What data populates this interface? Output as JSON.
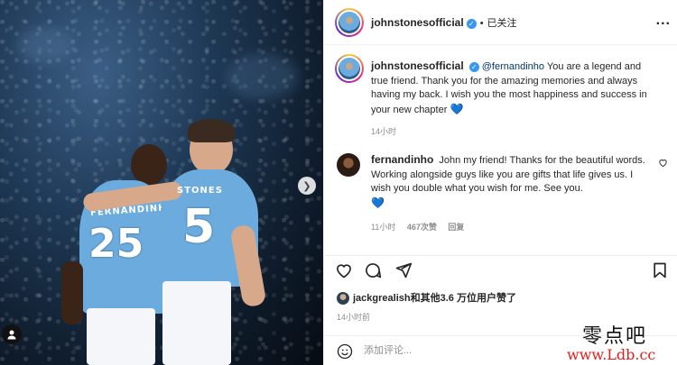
{
  "post": {
    "author": "johnstonesofficial",
    "follow_status": "已关注",
    "header_separator": "•",
    "more_label": "..."
  },
  "photo": {
    "jersey_left_name": "FERNANDINHO",
    "jersey_left_number": "25",
    "jersey_right_name": "STONES",
    "jersey_right_number": "5"
  },
  "caption": {
    "username": "johnstonesofficial",
    "mention": "@fernandinho",
    "text": "You are a legend and true friend. Thank you for the amazing memories and always having my back. I wish you the most happiness and success in your new chapter",
    "emoji": "💙",
    "time": "14小时"
  },
  "reply": {
    "username": "fernandinho",
    "text": "John my friend! Thanks for the beautiful words. Working alongside guys like you are gifts that life gives us. I wish you double what you wish for me. See you.",
    "emoji": "💙",
    "time": "11小时",
    "likes": "467次赞",
    "reply_label": "回复"
  },
  "actions": {
    "icons": [
      "heart-icon",
      "comment-icon",
      "share-icon",
      "bookmark-icon"
    ]
  },
  "likes": {
    "text": "jackgrealish和其他3.6 万位用户赞了"
  },
  "post_time": "14小时前",
  "comment_input": {
    "placeholder": "添加评论..."
  },
  "watermark": {
    "line1": "零点吧",
    "line2": "www.Ldb.cc"
  },
  "colors": {
    "verified": "#3897f0",
    "city_blue": "#6cabdd",
    "heart_blue": "#3fb4e8"
  }
}
